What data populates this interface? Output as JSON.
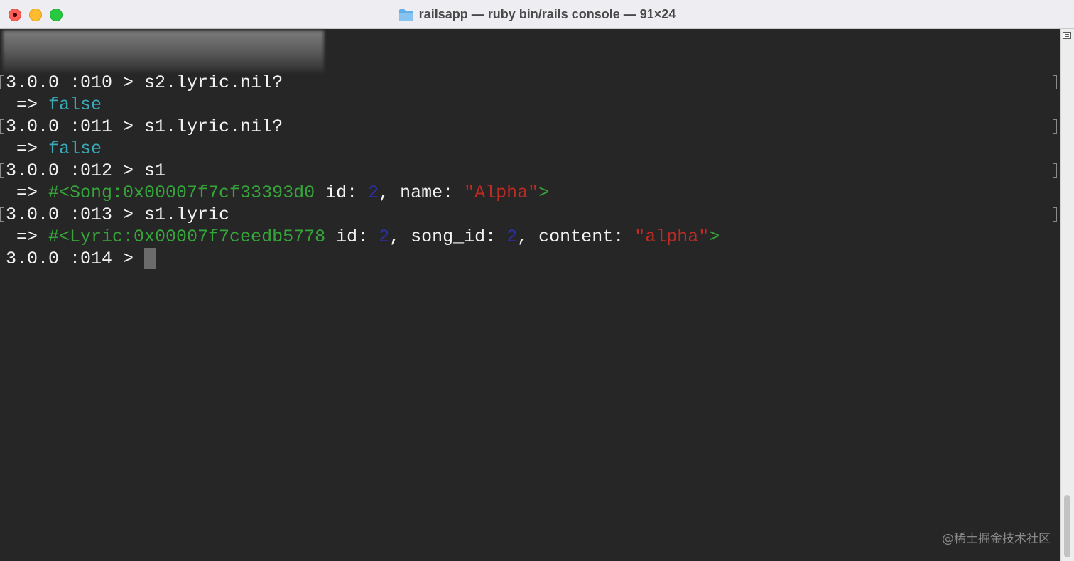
{
  "window": {
    "title": "railsapp — ruby bin/rails console — 91×24"
  },
  "terminal": {
    "lines": [
      {
        "prompt": "3.0.0 :010 > ",
        "command": "s2.lyric.nil?"
      },
      {
        "arrow": " => ",
        "value": "false"
      },
      {
        "prompt": "3.0.0 :011 > ",
        "command": "s1.lyric.nil?"
      },
      {
        "arrow": " => ",
        "value": "false"
      },
      {
        "prompt": "3.0.0 :012 > ",
        "command": "s1"
      },
      {
        "arrow": " => ",
        "obj": "#<Song:0x00007f7cf33393d0",
        "k1": " id: ",
        "v1": "2",
        "k2": ", name: ",
        "v2": "\"Alpha\"",
        "end": ">"
      },
      {
        "prompt": "3.0.0 :013 > ",
        "command": "s1.lyric"
      },
      {
        "arrow": " => ",
        "obj": "#<Lyric:0x00007f7ceedb5778",
        "k1": " id: ",
        "v1": "2",
        "k2": ", song_id: ",
        "v2": "2",
        "k3": ", content: ",
        "v3": "\"alpha\"",
        "end": ">"
      },
      {
        "prompt": "3.0.0 :014 > "
      }
    ]
  },
  "colors": {
    "background": "#262626",
    "boolean": "#3aa8b6",
    "object": "#35a53a",
    "number": "#2d2fa4",
    "string": "#bf2a23"
  },
  "watermark": "@稀土掘金技术社区"
}
